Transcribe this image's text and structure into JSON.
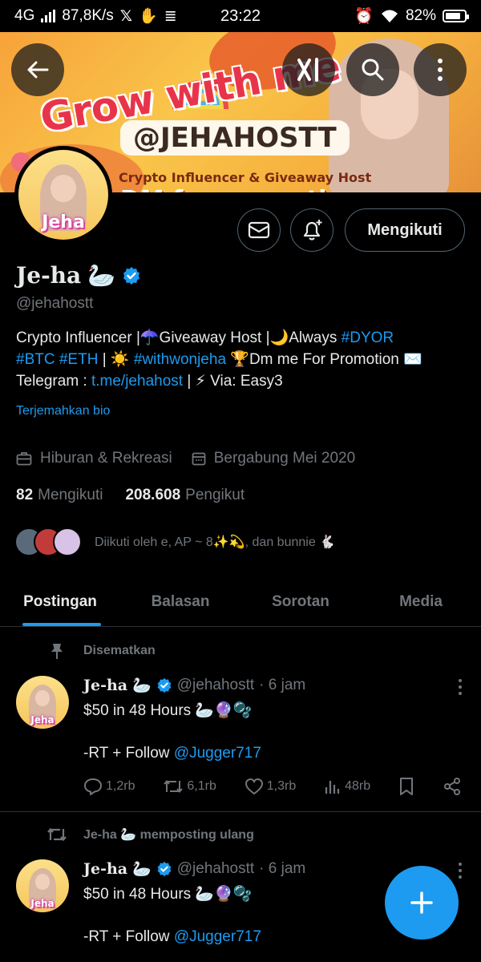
{
  "status_bar": {
    "network": "4G",
    "speed": "87,8K/s",
    "time": "23:22",
    "battery": "82%",
    "battery_level": 0.82
  },
  "banner": {
    "heading": "Grow with me",
    "handle": "@JEHAHOSTT",
    "tagline": "Crypto Influencer & Giveaway Host",
    "promo": "DM for promotion"
  },
  "profile": {
    "name": "Je-ha",
    "name_emoji": "🦢",
    "handle": "@jehahostt",
    "avatar_text": "Jeha",
    "follow_button": "Mengikuti",
    "bio_1a": "Crypto Influencer |☂️Giveaway Host |🌙Always ",
    "bio_1b": "#DYOR",
    "bio_2a": "#BTC",
    "bio_2b": "#ETH",
    "bio_2c": " | ☀️ ",
    "bio_2d": "#withwonjeha",
    "bio_2e": " 🏆Dm me For Promotion ✉️",
    "bio_3a": "Telegram : ",
    "bio_3b": "t.me/jehahost",
    "bio_3c": " | ⚡ Via: Easy3",
    "translate": "Terjemahkan bio",
    "category": "Hiburan & Rekreasi",
    "joined": "Bergabung Mei 2020",
    "following_count": "82",
    "following_label": "Mengikuti",
    "followers_count": "208.608",
    "followers_label": "Pengikut",
    "followed_by": "Diikuti oleh e, AP ~ 8✨💫, dan bunnie 🐇"
  },
  "tabs": [
    "Postingan",
    "Balasan",
    "Sorotan",
    "Media"
  ],
  "posts": [
    {
      "context": "Disematkan",
      "name": "Je-ha",
      "emoji": "🦢",
      "handle": "@jehahostt",
      "time": "· 6 jam",
      "line1": "$50 in 48 Hours 🦢🔮🫧",
      "line2a": "-RT + Follow ",
      "line2b": "@Jugger717",
      "replies": "1,2rb",
      "reposts": "6,1rb",
      "likes": "1,3rb",
      "views": "48rb"
    },
    {
      "context": "Je-ha 🦢 memposting ulang",
      "name": "Je-ha",
      "emoji": "🦢",
      "handle": "@jehahostt",
      "time": "· 6 jam",
      "line1": "$50 in 48 Hours 🦢🔮🫧",
      "line2a": "-RT + Follow ",
      "line2b": "@Jugger717"
    }
  ],
  "colors": {
    "accent": "#1d9bf0",
    "background": "#000000",
    "text_primary": "#e7e9ea",
    "text_secondary": "#71767b"
  }
}
